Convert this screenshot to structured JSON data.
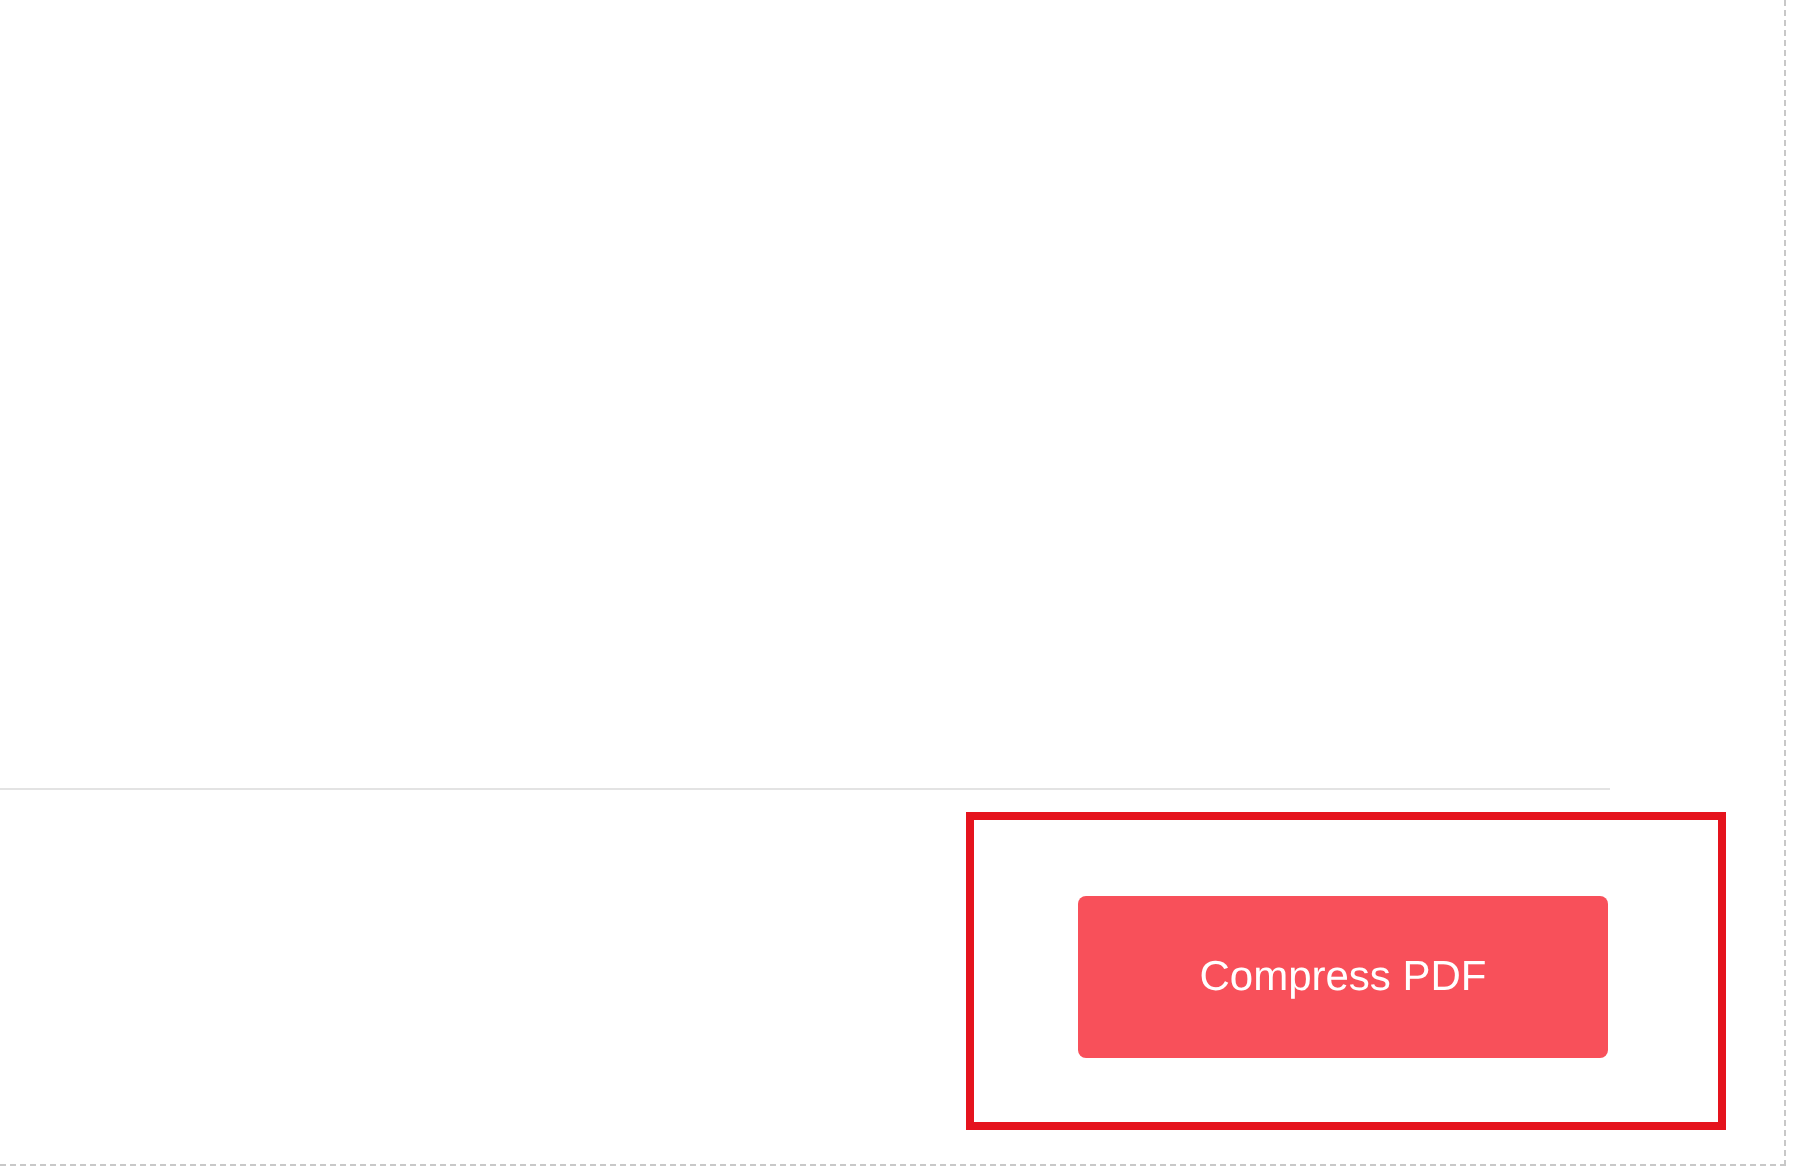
{
  "action_bar": {
    "button": {
      "label": "Compress PDF"
    }
  }
}
